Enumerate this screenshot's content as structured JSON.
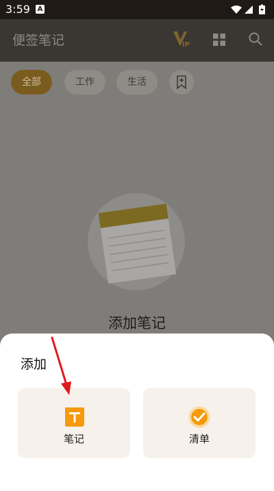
{
  "status_bar": {
    "time": "3:59",
    "notification_badge": "A"
  },
  "app_bar": {
    "title": "便签笔记",
    "icons": [
      "vip-icon",
      "grid-icon",
      "search-icon"
    ]
  },
  "tabs": [
    {
      "label": "全部",
      "active": true
    },
    {
      "label": "工作",
      "active": false
    },
    {
      "label": "生活",
      "active": false
    }
  ],
  "empty_state": {
    "message": "添加笔记"
  },
  "sheet": {
    "title": "添加",
    "options": [
      {
        "label": "笔记",
        "icon": "note-t-icon"
      },
      {
        "label": "清单",
        "icon": "check-circle-icon"
      }
    ]
  },
  "colors": {
    "accent": "#b58317",
    "icon_orange": "#f59a0b",
    "scrim": "#7f7d7a",
    "arrow": "#e2191e"
  }
}
